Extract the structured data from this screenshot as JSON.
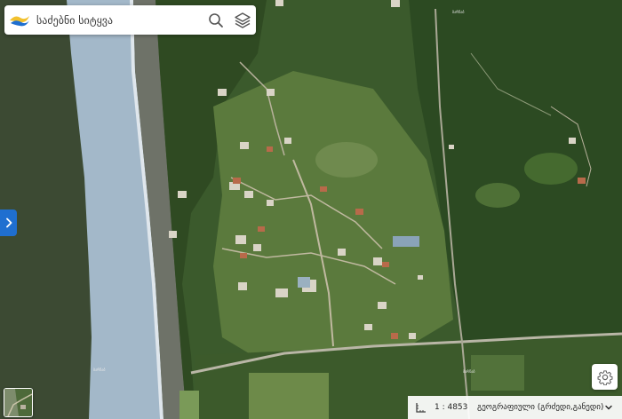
{
  "search": {
    "placeholder": "საძებნი სიტყვა"
  },
  "icons": {
    "logo": "app-logo",
    "search": "search-icon",
    "layers": "layers-icon",
    "side_toggle": "chevron-right-icon",
    "settings": "gear-icon",
    "ruler": "ruler-icon",
    "dropdown": "chevron-down-icon"
  },
  "bottom_bar": {
    "scale": "1 : 4853",
    "projection": "გეოგრაფიული (გრძედი,განედი)"
  },
  "colors": {
    "accent": "#1f6fd0",
    "sea": "#9fb6c8",
    "dark_water": "#3c4a33"
  }
}
